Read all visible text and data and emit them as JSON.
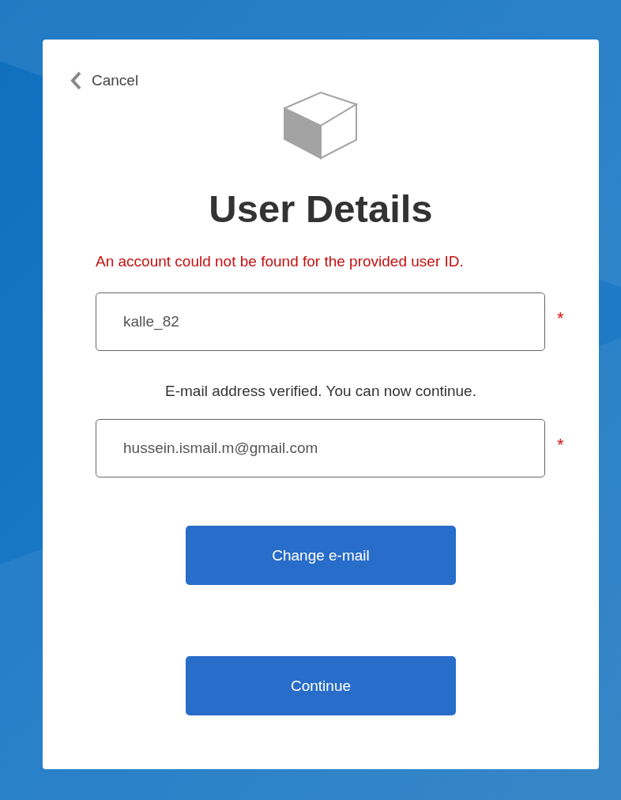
{
  "cancel_link": {
    "label": "Cancel"
  },
  "title": "User Details",
  "error_message": "An account could not be found for the provided user ID.",
  "fields": [
    {
      "value": "kalle_82",
      "required_mark": "*"
    },
    {
      "value": "hussein.ismail.m@gmail.com",
      "required_mark": "*",
      "message": "E-mail address verified. You can now continue."
    }
  ],
  "buttons": [
    {
      "label": "Change e-mail"
    },
    {
      "label": "Continue"
    }
  ]
}
